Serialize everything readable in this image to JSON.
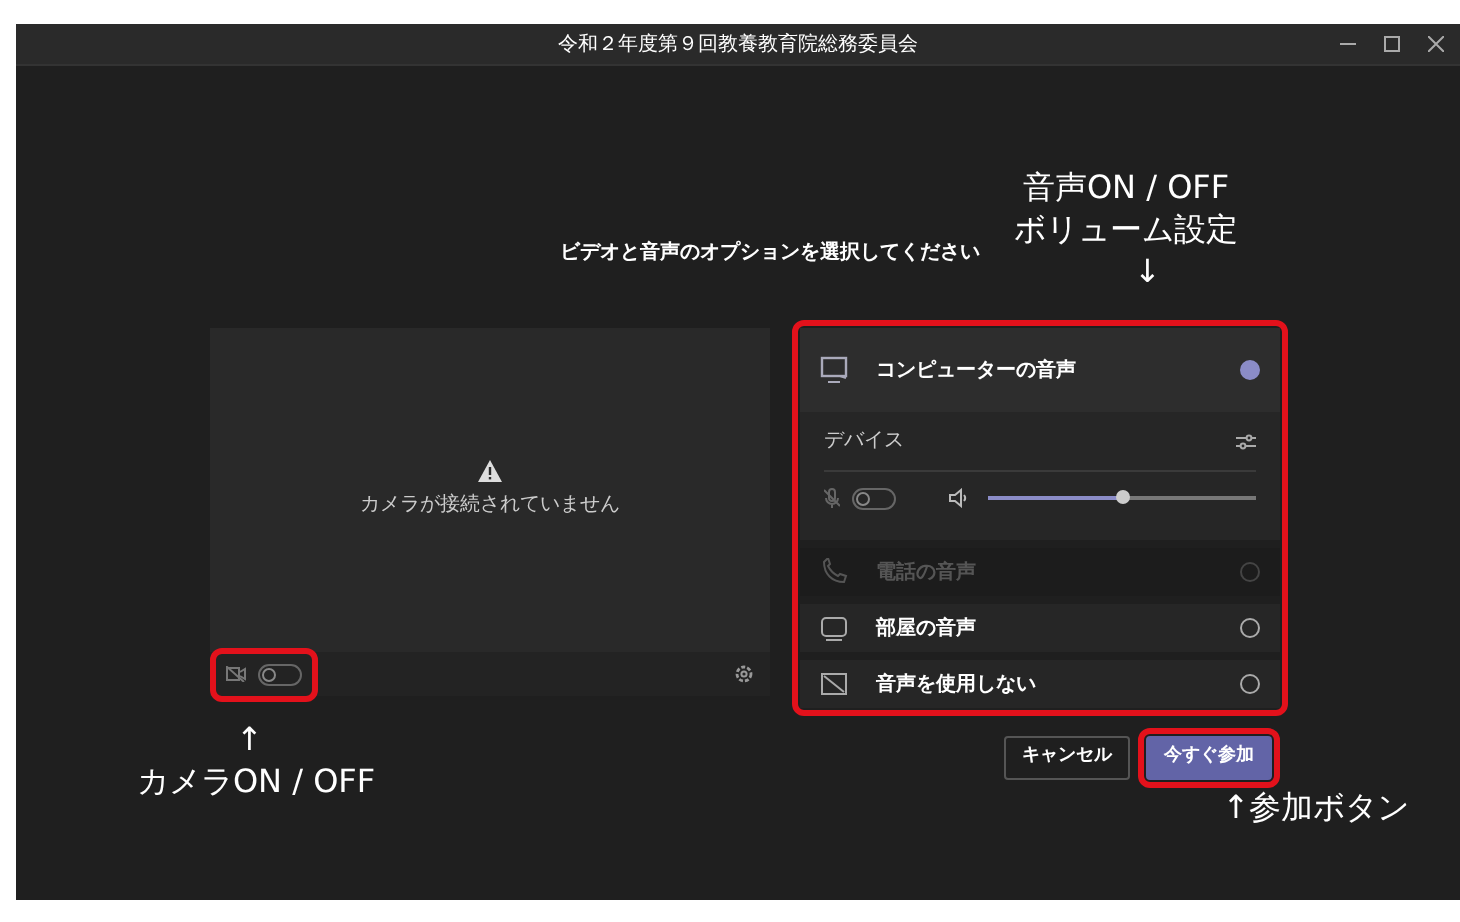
{
  "window": {
    "title": "令和２年度第９回教養教育院総務委員会"
  },
  "heading": "ビデオと音声のオプションを選択してください",
  "video_preview": {
    "message": "カメラが接続されていません",
    "camera_on": false
  },
  "audio_options": [
    {
      "kind": "computer",
      "label": "コンピューターの音声",
      "selected": true,
      "disabled": false
    },
    {
      "kind": "phone",
      "label": "電話の音声",
      "selected": false,
      "disabled": true
    },
    {
      "kind": "room",
      "label": "部屋の音声",
      "selected": false,
      "disabled": false
    },
    {
      "kind": "none",
      "label": "音声を使用しない",
      "selected": false,
      "disabled": false
    }
  ],
  "device_settings": {
    "label": "デバイス",
    "mic_on": false,
    "volume": {
      "level": 0.5
    }
  },
  "buttons": [
    {
      "label": "キャンセル",
      "kind": "secondary"
    },
    {
      "label": "今すぐ参加",
      "kind": "primary"
    }
  ],
  "annotations": [
    {
      "kind": "audio",
      "lines": [
        "音声ON / OFF",
        "ボリューム設定"
      ],
      "arrow": "↓"
    },
    {
      "kind": "camera",
      "lines": [
        "カメラON / OFF"
      ],
      "arrow": "↑"
    },
    {
      "kind": "join",
      "lines": [
        "↑参加ボタン"
      ]
    }
  ]
}
